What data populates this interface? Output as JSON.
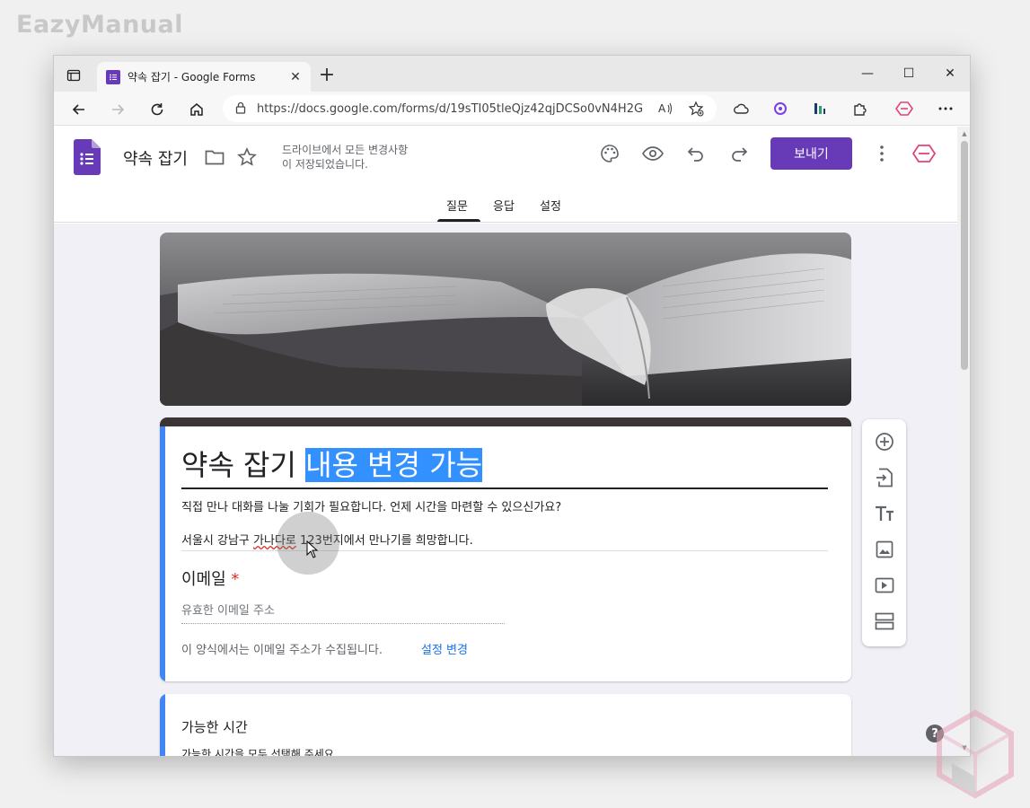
{
  "watermark": "EazyManual",
  "browser": {
    "tab_title": "약속 잡기 - Google Forms",
    "tab_close": "✕",
    "new_tab": "+",
    "url": "https://docs.google.com/forms/d/19sTI05tleQjz42qjDCSo0vN4H2G...",
    "win_minimize": "—",
    "win_maximize": "☐",
    "win_close": "✕"
  },
  "forms_header": {
    "doc_title": "약속 잡기",
    "save_status_line1": "드라이브에서 모든 변경사항",
    "save_status_line2": "이 저장되었습니다.",
    "send_label": "보내기",
    "tabs": [
      {
        "label": "질문",
        "active": true
      },
      {
        "label": "응답",
        "active": false
      },
      {
        "label": "설정",
        "active": false
      }
    ]
  },
  "form": {
    "title_plain": "약속 잡기 ",
    "title_highlight": "내용 변경 가능",
    "description_line1": "직접 만나 대화를 나눌 기회가 필요합니다. 언제 시간을 마련할 수 있으신가요?",
    "description_line2_a": "서울시 강남구 ",
    "description_line2_squiggle": "가나다로",
    "description_line2_b": " 123번지에서 만나기를 희망합니다.",
    "email_label": "이메일",
    "required_mark": "*",
    "email_placeholder": "유효한 이메일 주소",
    "collect_note": "이 양식에서는 이메일 주소가 수집됩니다.",
    "collect_link": "설정 변경",
    "question_title": "가능한 시간",
    "question_desc": "가능한 시간을 모두 선택해 주세요."
  },
  "help_label": "?",
  "colors": {
    "brand_purple": "#673ab7",
    "accent_blue": "#4285f4",
    "highlight": "#3390ff",
    "required_red": "#d93025"
  }
}
